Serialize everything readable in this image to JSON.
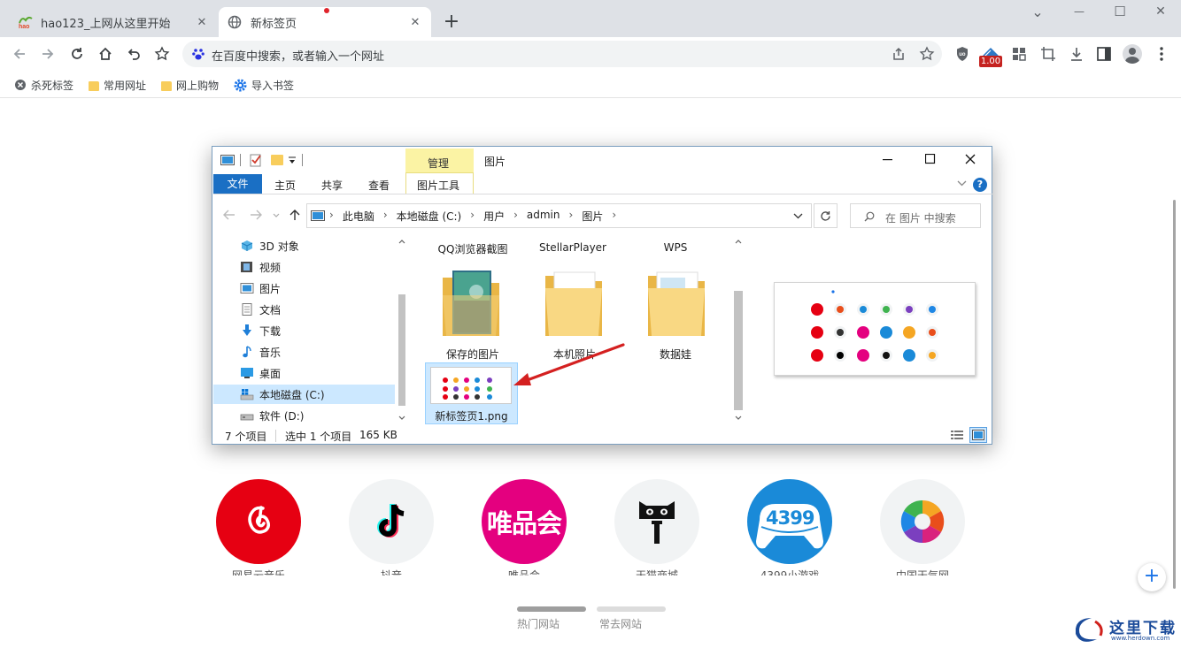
{
  "browser": {
    "tabs": [
      {
        "title": "hao123_上网从这里开始",
        "close": "✕"
      },
      {
        "title": "新标签页",
        "close": "✕"
      }
    ],
    "new_tab": "+",
    "window_controls": {
      "dropdown": "⌄",
      "minimize": "—",
      "maximize": "☐",
      "close": "✕"
    },
    "omnibox_placeholder": "在百度中搜索，或者输入一个网址",
    "extension_badge": "1.00",
    "bookmarks": [
      "杀死标签",
      "常用网址",
      "网上购物",
      "导入书签"
    ]
  },
  "newtab": {
    "sites": [
      {
        "label": "网易云音乐",
        "color": "#e60012"
      },
      {
        "label": "抖音",
        "color": "#000000"
      },
      {
        "label": "唯品会",
        "color": "#e4007f"
      },
      {
        "label": "天猫商城",
        "color": "#000000"
      },
      {
        "label": "4399小游戏",
        "color": "#1a8ad8"
      },
      {
        "label": "中国天气网",
        "color": "#f5a623"
      }
    ],
    "vipshop_text": "唯品会",
    "game_text": "4399",
    "pager": [
      "热门网站",
      "常去网站"
    ],
    "add_button": "+"
  },
  "explorer": {
    "ribbon_context_tab": "管理",
    "window_title": "图片",
    "ribbon_tabs": [
      "文件",
      "主页",
      "共享",
      "查看"
    ],
    "ribbon_context_sub": "图片工具",
    "help": "?",
    "address_parts": [
      "此电脑",
      "本地磁盘 (C:)",
      "用户",
      "admin",
      "图片"
    ],
    "search_placeholder": "在 图片 中搜索",
    "nav_items": [
      "3D 对象",
      "视频",
      "图片",
      "文档",
      "下载",
      "音乐",
      "桌面",
      "本地磁盘 (C:)",
      "软件 (D:)"
    ],
    "top_folder_labels": [
      "QQ浏览器截图",
      "StellarPlayer",
      "WPS"
    ],
    "folders": [
      "保存的图片",
      "本机照片",
      "数据娃"
    ],
    "selected_file": "新标签页1.png",
    "status": {
      "count": "7 个项目",
      "selected": "选中 1 个项目",
      "size": "165 KB"
    }
  },
  "watermark": {
    "text": "这里下载",
    "url": "www.herdown.com"
  }
}
